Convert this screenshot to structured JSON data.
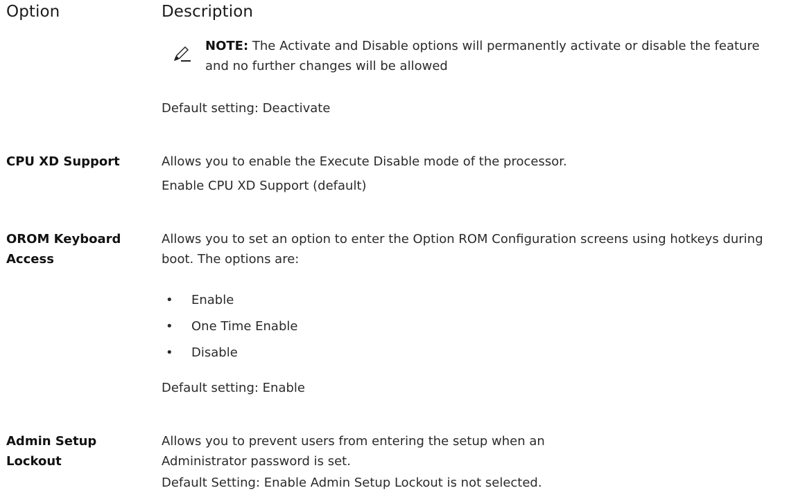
{
  "header": {
    "option": "Option",
    "description": "Description"
  },
  "note": {
    "icon": "pencil-note-icon",
    "label": "NOTE:",
    "text": "The Activate and Disable options will permanently activate or disable the feature and no further changes will be allowed"
  },
  "trusted_execution": {
    "default": "Default setting: Deactivate"
  },
  "cpu_xd": {
    "name": "CPU XD Support",
    "line1": "Allows you to enable the Execute Disable mode of the processor.",
    "line2": "Enable CPU XD Support (default)"
  },
  "orom": {
    "name": "OROM Keyboard Access",
    "description": "Allows you to set an option to enter the Option ROM Configuration screens using hotkeys during boot. The options are:",
    "options": [
      "Enable",
      "One Time Enable",
      "Disable"
    ],
    "default": "Default setting: Enable"
  },
  "admin_lockout": {
    "name": "Admin Setup Lockout",
    "description": "Allows you to prevent users from entering the setup when an Administrator password is set.",
    "default": "Default Setting: Enable Admin Setup Lockout is not selected."
  }
}
